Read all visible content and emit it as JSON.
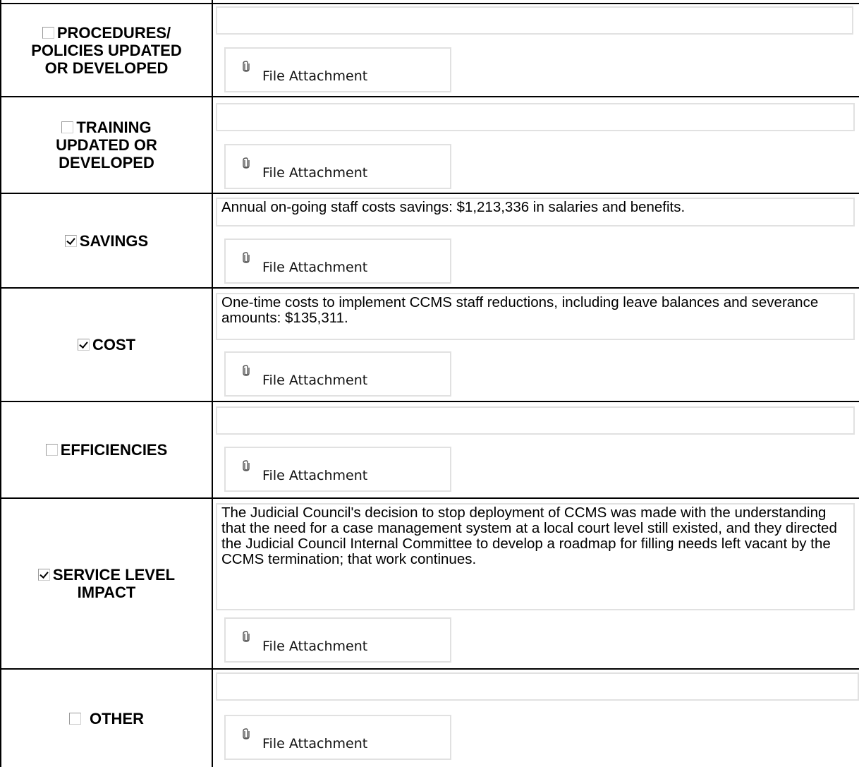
{
  "rows": [
    {
      "label_lines": [
        "PROCEDURES/",
        "POLICIES UPDATED",
        "OR DEVELOPED"
      ],
      "checked": false,
      "text": "",
      "attachment_label": "File Attachment",
      "clip_icon": "paperclip-icon"
    },
    {
      "label_lines": [
        "TRAINING",
        "UPDATED OR",
        "DEVELOPED"
      ],
      "checked": false,
      "text": "",
      "attachment_label": "File Attachment",
      "clip_icon": "paperclip-icon"
    },
    {
      "label_lines": [
        "SAVINGS"
      ],
      "checked": true,
      "text": "Annual on-going staff costs savings: $1,213,336 in salaries and benefits.",
      "attachment_label": "File Attachment",
      "clip_icon": "paperclip-icon"
    },
    {
      "label_lines": [
        "COST"
      ],
      "checked": true,
      "text": "One-time costs to implement CCMS staff reductions, including leave balances and severance amounts: $135,311.",
      "attachment_label": "File Attachment",
      "clip_icon": "paperclip-icon"
    },
    {
      "label_lines": [
        "EFFICIENCIES"
      ],
      "checked": false,
      "text": "",
      "attachment_label": "File Attachment",
      "clip_icon": "paperclip-icon"
    },
    {
      "label_lines": [
        "SERVICE LEVEL",
        "IMPACT"
      ],
      "checked": true,
      "text": "The Judicial Council's decision to stop deployment of CCMS was made with the understanding that the need for a case management system at a local court level still existed, and they directed the Judicial Council Internal Committee to develop a roadmap for filling needs left vacant by the CCMS termination; that work continues.",
      "attachment_label": "File Attachment",
      "clip_icon": "paperclip-icon"
    },
    {
      "label_lines": [
        "OTHER"
      ],
      "checked": false,
      "text": "",
      "attachment_label": "File Attachment",
      "clip_icon": "paperclip-icon"
    }
  ]
}
